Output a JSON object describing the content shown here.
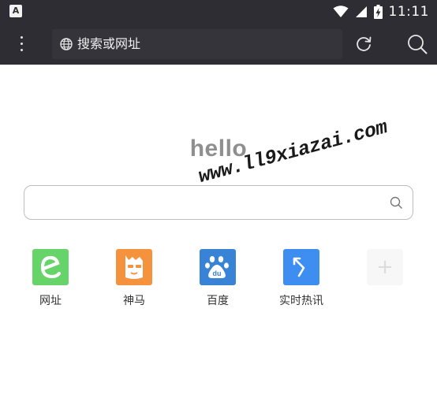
{
  "status_bar": {
    "app_icon_label": "A",
    "time": "11:11"
  },
  "toolbar": {
    "url_placeholder": "搜索或网址"
  },
  "main": {
    "hello": "hello",
    "watermark": "www.ll9xiazai.com"
  },
  "quick_links": [
    {
      "label": "网址",
      "color": "#66d468",
      "icon": "e-letter-icon"
    },
    {
      "label": "神马",
      "color": "#f5923e",
      "icon": "shenma-alpaca-icon"
    },
    {
      "label": "百度",
      "color": "#3883d6",
      "icon": "baidu-paw-icon"
    },
    {
      "label": "实时热讯",
      "color": "#3d8ef0",
      "icon": "hot-news-arrow-icon"
    }
  ],
  "add_label": "+",
  "colors": {
    "toolbar_bg": "#2e2d33",
    "urlbar_bg": "#35343a",
    "hello_text": "#8f8f8f"
  }
}
